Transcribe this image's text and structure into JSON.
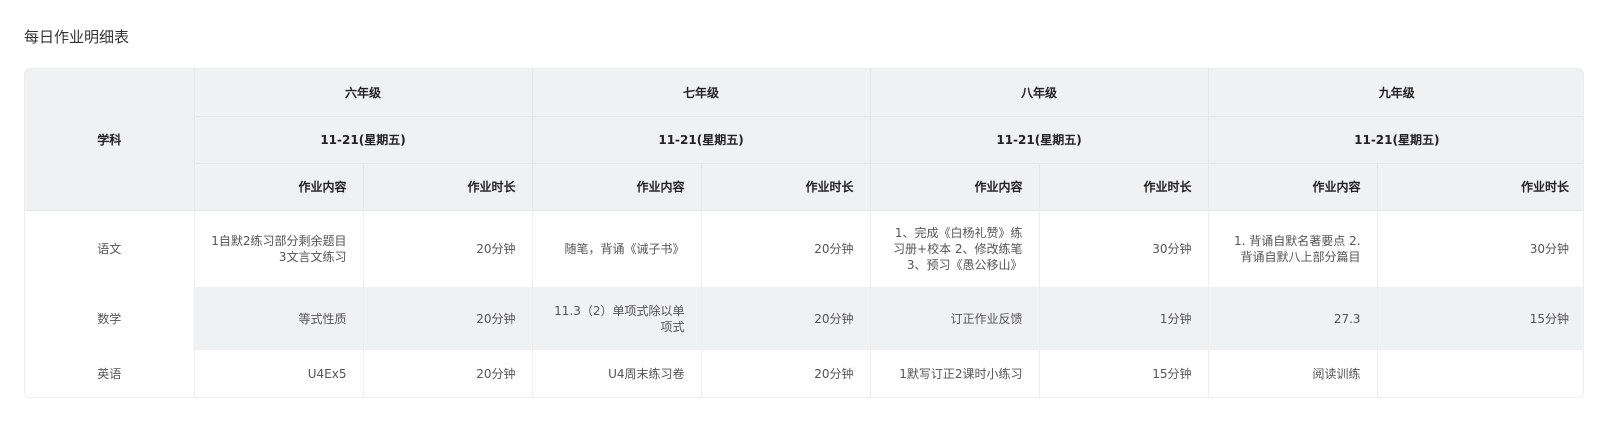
{
  "page": {
    "title": "每日作业明细表"
  },
  "table": {
    "subject_header": "学科",
    "grades": [
      {
        "name": "六年级",
        "date": "11-21(星期五)"
      },
      {
        "name": "七年级",
        "date": "11-21(星期五)"
      },
      {
        "name": "八年级",
        "date": "11-21(星期五)"
      },
      {
        "name": "九年级",
        "date": "11-21(星期五)"
      }
    ],
    "col_content": "作业内容",
    "col_duration": "作业时长",
    "rows": [
      {
        "subject": "语文",
        "cells": [
          {
            "content": "1自默2练习部分剩余题目3文言文练习",
            "duration": "20分钟"
          },
          {
            "content": "随笔，背诵《诫子书》",
            "duration": "20分钟"
          },
          {
            "content": "1、完成《白杨礼赞》练习册+校本 2、修改练笔 3、预习《愚公移山》",
            "duration": "30分钟"
          },
          {
            "content": "1. 背诵自默名著要点 2. 背诵自默八上部分篇目",
            "duration": "30分钟"
          }
        ]
      },
      {
        "subject": "数学",
        "cells": [
          {
            "content": "等式性质",
            "duration": "20分钟"
          },
          {
            "content": "11.3（2）单项式除以单项式",
            "duration": "20分钟"
          },
          {
            "content": "订正作业反馈",
            "duration": "1分钟"
          },
          {
            "content": "27.3",
            "duration": "15分钟"
          }
        ]
      },
      {
        "subject": "英语",
        "cells": [
          {
            "content": "U4Ex5",
            "duration": "20分钟"
          },
          {
            "content": "U4周末练习卷",
            "duration": "20分钟"
          },
          {
            "content": "1默写订正2课时小练习",
            "duration": "15分钟"
          },
          {
            "content": "阅读训练",
            "duration": ""
          }
        ]
      }
    ]
  }
}
